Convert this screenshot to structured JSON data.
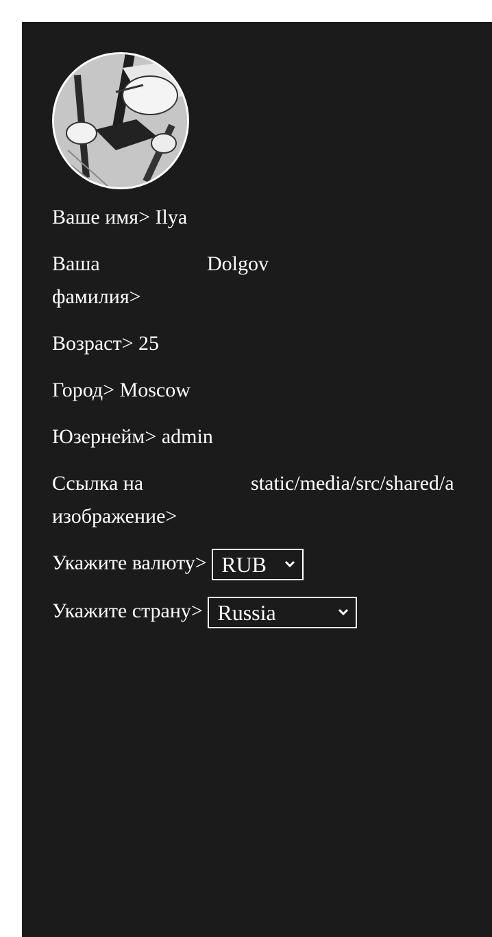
{
  "profile": {
    "avatar_alt": "avatar",
    "fields": {
      "name_label": "Ваше имя>",
      "name_value": "Ilya",
      "surname_label": "Ваша фамилия>",
      "surname_value": "Dolgov",
      "age_label": "Возраст>",
      "age_value": "25",
      "city_label": "Город>",
      "city_value": "Moscow",
      "username_label": "Юзернейм>",
      "username_value": "admin",
      "image_link_label": "Ссылка на изображение>",
      "image_link_value": "static/media/src/shared/a"
    },
    "currency": {
      "label": "Укажите валюту>",
      "selected": "RUB"
    },
    "country": {
      "label": "Укажите страну>",
      "selected": "Russia"
    }
  },
  "colors": {
    "page_background": "#ffffff",
    "panel_background": "#1b1b1b",
    "text": "#ffffff"
  },
  "icons": {
    "currency_dropdown": "chevron-down-icon",
    "country_dropdown": "chevron-down-icon"
  }
}
